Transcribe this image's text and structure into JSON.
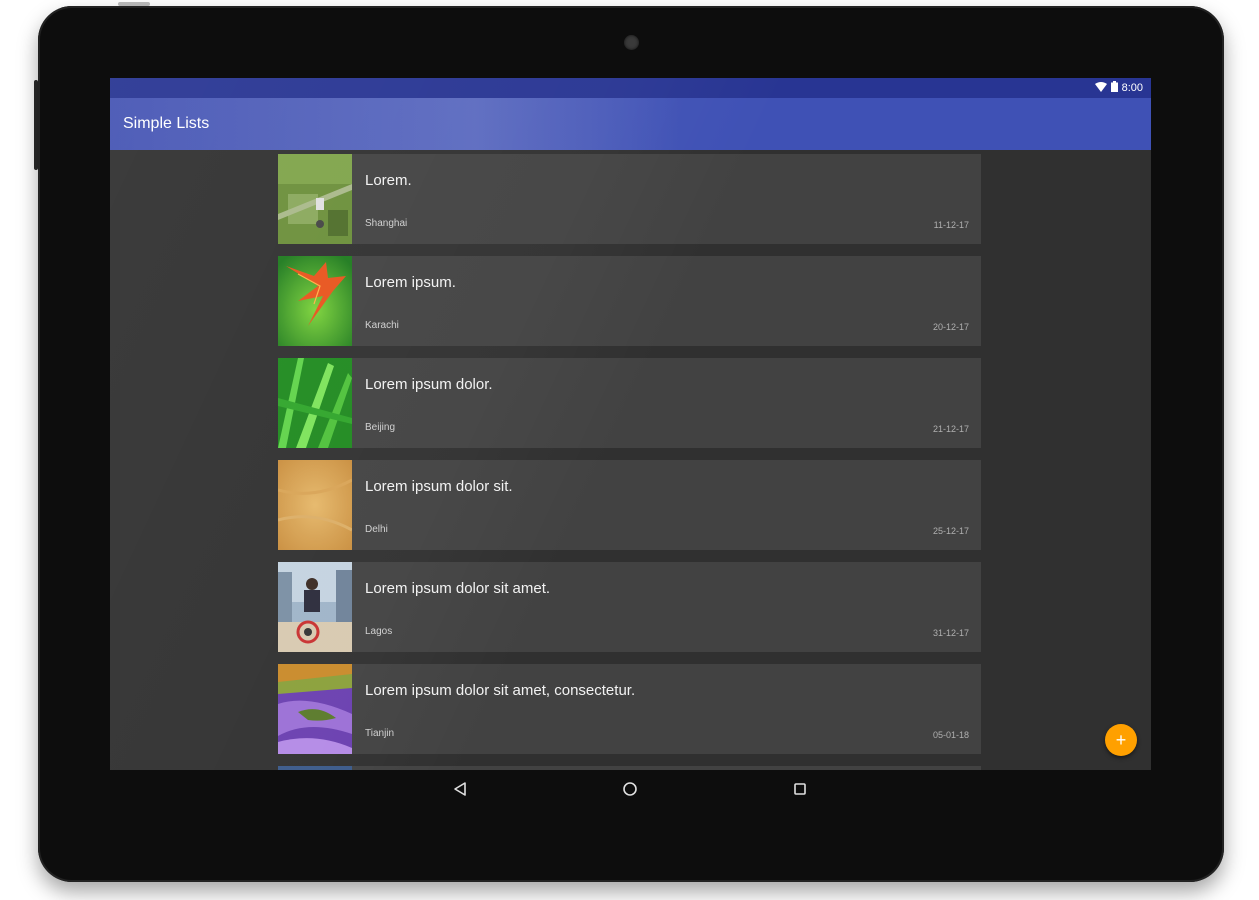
{
  "status_bar": {
    "time": "8:00"
  },
  "app_bar": {
    "title": "Simple Lists"
  },
  "items": [
    {
      "title": "Lorem.",
      "city": "Shanghai",
      "date": "11-12-17"
    },
    {
      "title": "Lorem ipsum.",
      "city": "Karachi",
      "date": "20-12-17"
    },
    {
      "title": "Lorem ipsum dolor.",
      "city": "Beijing",
      "date": "21-12-17"
    },
    {
      "title": "Lorem ipsum dolor sit.",
      "city": "Delhi",
      "date": "25-12-17"
    },
    {
      "title": "Lorem ipsum dolor sit amet.",
      "city": "Lagos",
      "date": "31-12-17"
    },
    {
      "title": "Lorem ipsum dolor sit amet, consectetur.",
      "city": "Tianjin",
      "date": "05-01-18"
    }
  ],
  "fab": {
    "icon": "plus-icon",
    "label": "+"
  },
  "nav": {
    "back": "back-icon",
    "home": "home-icon",
    "recents": "recents-icon"
  },
  "colors": {
    "primary": "#3f51b5",
    "primary_dark": "#283593",
    "accent": "#ffa000",
    "background": "#303030",
    "card": "#424242"
  }
}
